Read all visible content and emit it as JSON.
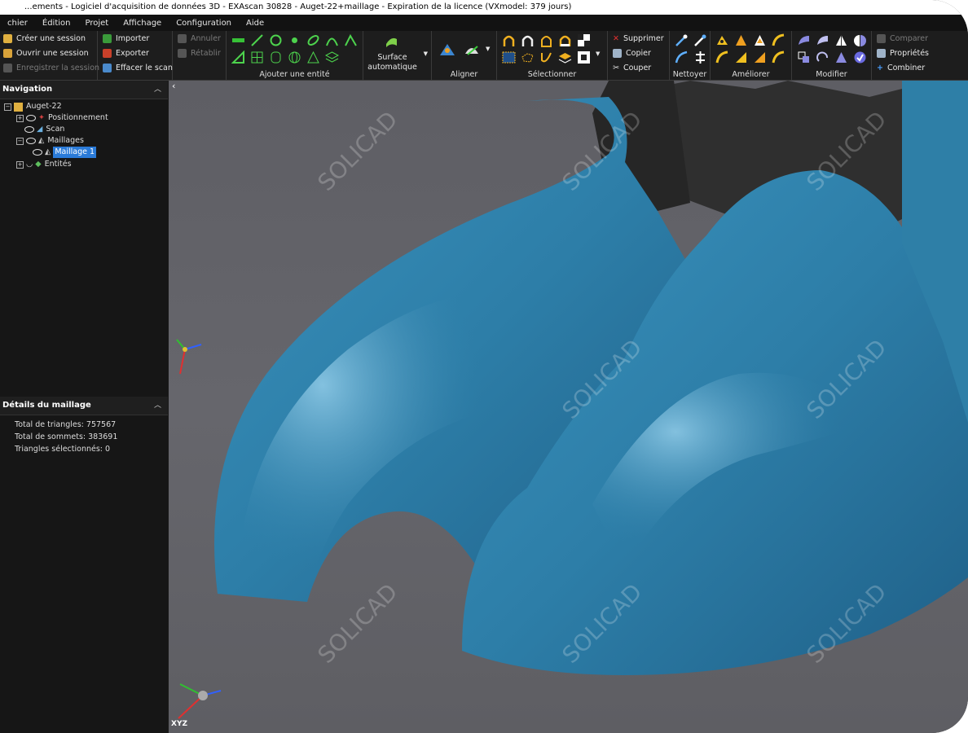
{
  "window": {
    "title": "...ements - Logiciel d'acquisition de données 3D - EXAscan 30828 - Auget-22+maillage - Expiration de la licence (VXmodel: 379 jours)"
  },
  "menu": [
    "chier",
    "Édition",
    "Projet",
    "Affichage",
    "Configuration",
    "Aide"
  ],
  "ribbon": {
    "session": {
      "create": "Créer une session",
      "open": "Ouvrir une session",
      "save": "Enregistrer la session"
    },
    "file": {
      "import": "Importer",
      "export": "Exporter",
      "clear": "Effacer le scan"
    },
    "history": {
      "undo": "Annuler",
      "redo": "Rétablir"
    },
    "groups": {
      "add_entity": "Ajouter une entité",
      "surface_line1": "Surface",
      "surface_line2": "automatique",
      "align": "Aligner",
      "select": "Sélectionner",
      "clean": "Nettoyer",
      "improve": "Améliorer",
      "modify": "Modifier"
    },
    "edit": {
      "delete": "Supprimer",
      "copy": "Copier",
      "cut": "Couper"
    },
    "compare": {
      "compare": "Comparer",
      "properties": "Propriétés",
      "combine": "Combiner"
    }
  },
  "navigation": {
    "title": "Navigation",
    "tree": {
      "root": "Auget-22",
      "positioning": "Positionnement",
      "scan": "Scan",
      "meshes": "Maillages",
      "mesh1": "Maillage 1",
      "entities": "Entités"
    }
  },
  "details": {
    "title": "Détails du maillage",
    "triangles": "Total de triangles: 757567",
    "vertices": "Total de sommets: 383691",
    "selected": "Triangles sélectionnés: 0"
  },
  "viewport": {
    "watermark": "SOLICAD",
    "axes": "XYZ"
  },
  "colors": {
    "mesh": "#2e7fa7",
    "viewport": "#626268",
    "ribbon": "#1d1d1d"
  }
}
